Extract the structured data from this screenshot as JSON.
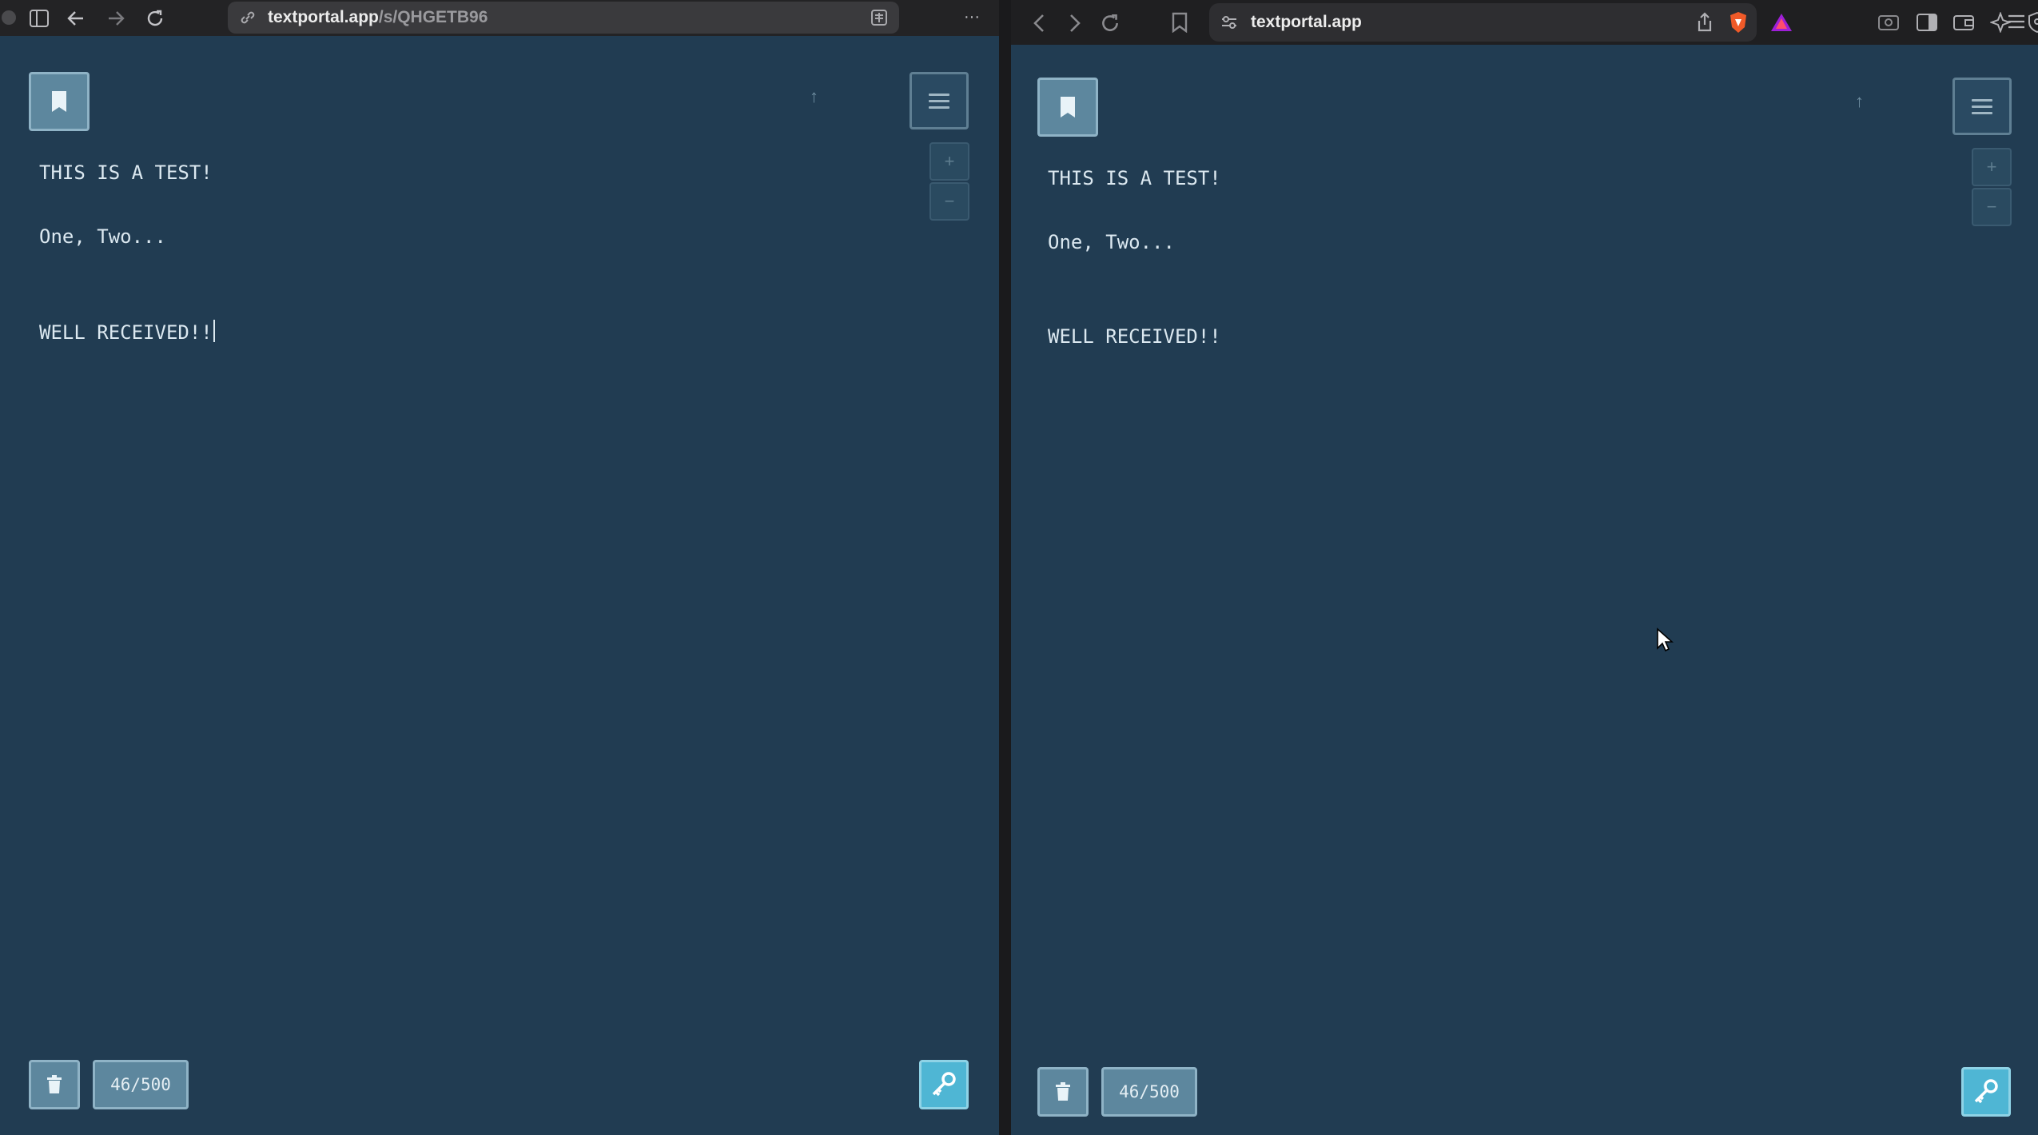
{
  "left_window": {
    "url_host": "textportal.app",
    "url_path": "/s/QHGETB96",
    "more_label": "···"
  },
  "right_window": {
    "url_host": "textportal.app"
  },
  "note": {
    "lines": [
      "THIS IS A TEST!",
      "One, Two...",
      "",
      "WELL RECEIVED!!"
    ],
    "counter": "46/500",
    "zoom_in": "+",
    "zoom_out": "−",
    "scroll_top": "↑"
  },
  "colors": {
    "background": "#213c52",
    "button": "#5d879e",
    "key_button": "#4fb6d4"
  }
}
